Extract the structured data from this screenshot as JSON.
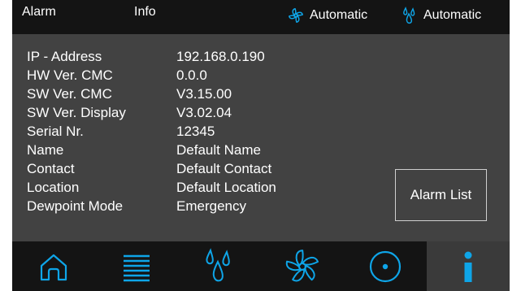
{
  "header": {
    "tabs": [
      {
        "label": "Alarm"
      },
      {
        "label": "Info"
      }
    ],
    "fan_status": {
      "icon": "fan-icon",
      "label": "Automatic"
    },
    "dewpoint_status": {
      "icon": "drops-icon",
      "label": "Automatic"
    }
  },
  "info": {
    "rows": [
      {
        "label": "IP - Address",
        "value": "192.168.0.190"
      },
      {
        "label": "HW Ver. CMC",
        "value": "0.0.0"
      },
      {
        "label": "SW Ver. CMC",
        "value": "V3.15.00"
      },
      {
        "label": "SW Ver. Display",
        "value": "V3.02.04"
      },
      {
        "label": "Serial Nr.",
        "value": "12345"
      },
      {
        "label": "Name",
        "value": "Default Name"
      },
      {
        "label": "Contact",
        "value": "Default Contact"
      },
      {
        "label": "Location",
        "value": "Default Location"
      },
      {
        "label": "Dewpoint Mode",
        "value": "Emergency"
      }
    ]
  },
  "buttons": {
    "alarm_list": "Alarm List"
  },
  "nav": {
    "items": [
      {
        "icon": "home-icon"
      },
      {
        "icon": "menu-lines-icon"
      },
      {
        "icon": "drops-icon"
      },
      {
        "icon": "fan-icon"
      },
      {
        "icon": "target-icon"
      },
      {
        "icon": "info-icon",
        "active": true
      }
    ]
  },
  "colors": {
    "accent": "#0ea5e8",
    "screen_bg": "#424242",
    "bar_bg": "#141414",
    "text": "#ffffff"
  }
}
